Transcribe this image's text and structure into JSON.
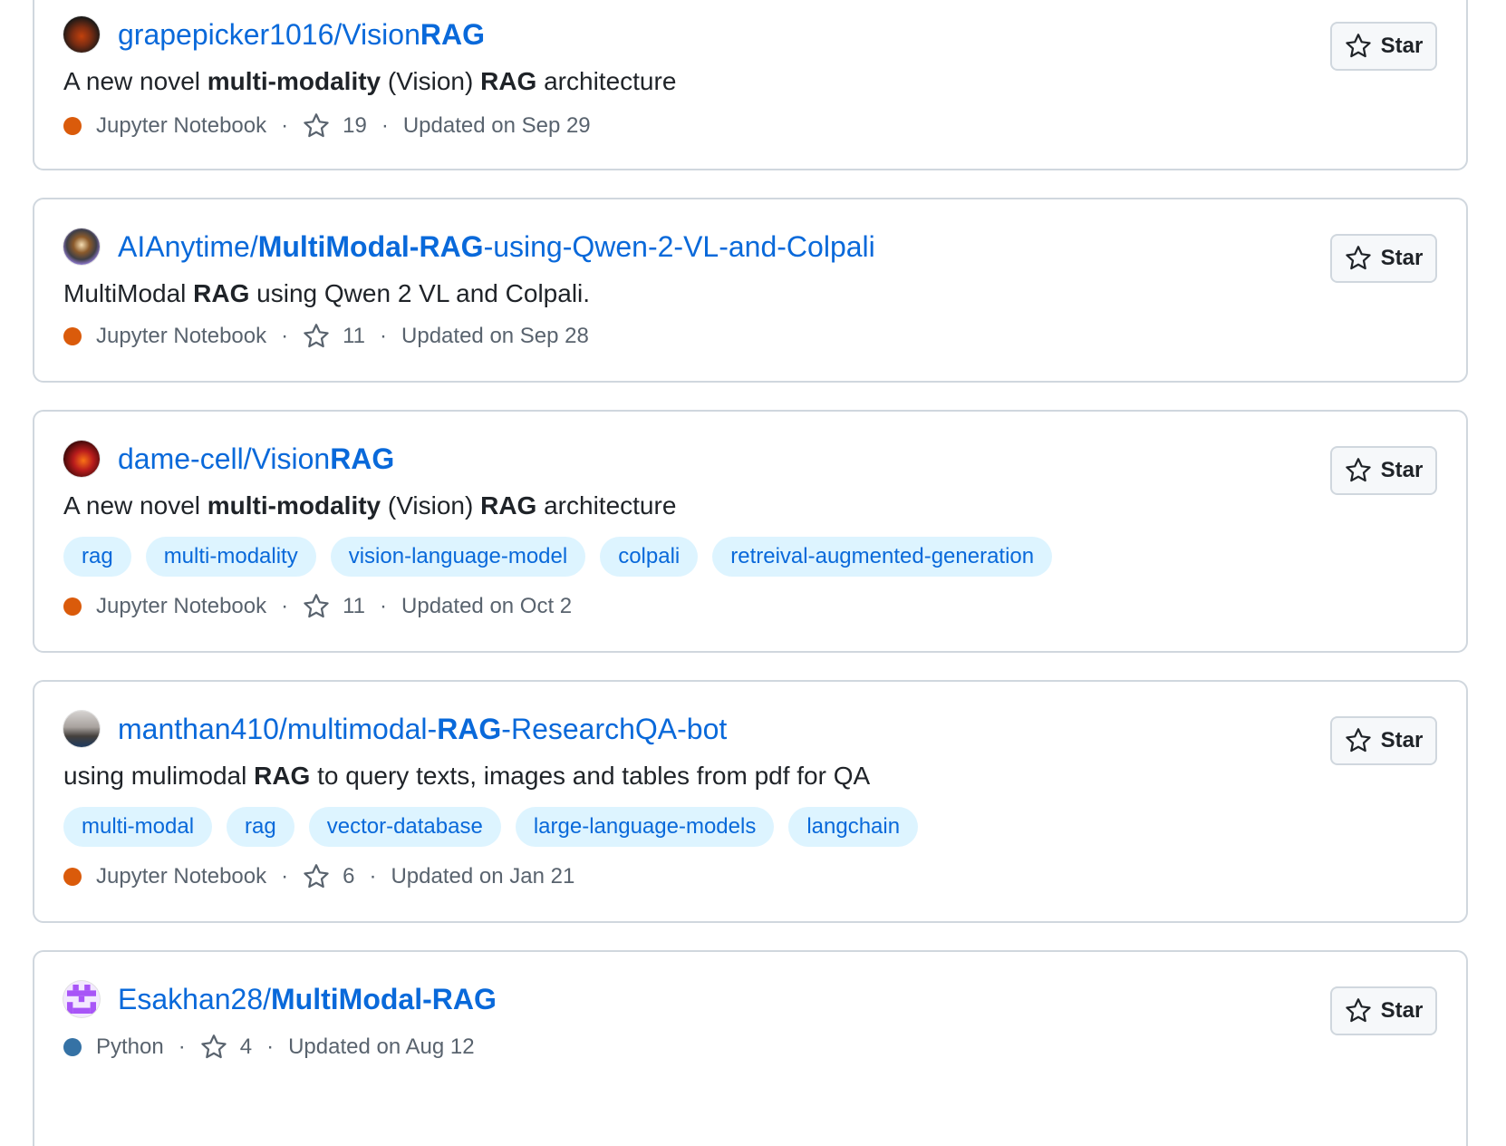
{
  "repos": [
    {
      "owner": "grapepicker1016/",
      "name_parts": [
        {
          "t": "Vision",
          "b": false
        },
        {
          "t": "RAG",
          "b": true
        }
      ],
      "desc_parts": [
        {
          "t": "A new novel ",
          "b": false
        },
        {
          "t": "multi-modality",
          "b": true
        },
        {
          "t": " (Vision) ",
          "b": false
        },
        {
          "t": "RAG",
          "b": true
        },
        {
          "t": " architecture",
          "b": false
        }
      ],
      "topics": [],
      "language": "Jupyter Notebook",
      "language_color": "#DA5B0B",
      "stars": "19",
      "updated": "Updated on Sep 29",
      "star_label": "Star"
    },
    {
      "owner": "AIAnytime/",
      "name_parts": [
        {
          "t": "MultiModal-RAG",
          "b": true
        },
        {
          "t": "-using-Qwen-2-VL-and-Colpali",
          "b": false
        }
      ],
      "desc_parts": [
        {
          "t": "MultiModal ",
          "b": false
        },
        {
          "t": "RAG",
          "b": true
        },
        {
          "t": " using Qwen 2 VL and Colpali.",
          "b": false
        }
      ],
      "topics": [],
      "language": "Jupyter Notebook",
      "language_color": "#DA5B0B",
      "stars": "11",
      "updated": "Updated on Sep 28",
      "star_label": "Star"
    },
    {
      "owner": "dame-cell/",
      "name_parts": [
        {
          "t": "Vision",
          "b": false
        },
        {
          "t": "RAG",
          "b": true
        }
      ],
      "desc_parts": [
        {
          "t": "A new novel ",
          "b": false
        },
        {
          "t": "multi-modality",
          "b": true
        },
        {
          "t": " (Vision) ",
          "b": false
        },
        {
          "t": "RAG",
          "b": true
        },
        {
          "t": " architecture",
          "b": false
        }
      ],
      "topics": [
        "rag",
        "multi-modality",
        "vision-language-model",
        "colpali",
        "retreival-augmented-generation"
      ],
      "language": "Jupyter Notebook",
      "language_color": "#DA5B0B",
      "stars": "11",
      "updated": "Updated on Oct 2",
      "star_label": "Star"
    },
    {
      "owner": "manthan410/",
      "name_parts": [
        {
          "t": "multimodal-",
          "b": false
        },
        {
          "t": "RAG",
          "b": true
        },
        {
          "t": "-ResearchQA-bot",
          "b": false
        }
      ],
      "desc_parts": [
        {
          "t": "using mulimodal ",
          "b": false
        },
        {
          "t": "RAG",
          "b": true
        },
        {
          "t": " to query texts, images and tables from pdf for QA",
          "b": false
        }
      ],
      "topics": [
        "multi-modal",
        "rag",
        "vector-database",
        "large-language-models",
        "langchain"
      ],
      "language": "Jupyter Notebook",
      "language_color": "#DA5B0B",
      "stars": "6",
      "updated": "Updated on Jan 21",
      "star_label": "Star"
    },
    {
      "owner": "Esakhan28/",
      "name_parts": [
        {
          "t": "MultiModal-RAG",
          "b": true
        }
      ],
      "desc_parts": [],
      "topics": [],
      "language": "Python",
      "language_color": "#3572A5",
      "stars": "4",
      "updated": "Updated on Aug 12",
      "star_label": "Star"
    }
  ]
}
